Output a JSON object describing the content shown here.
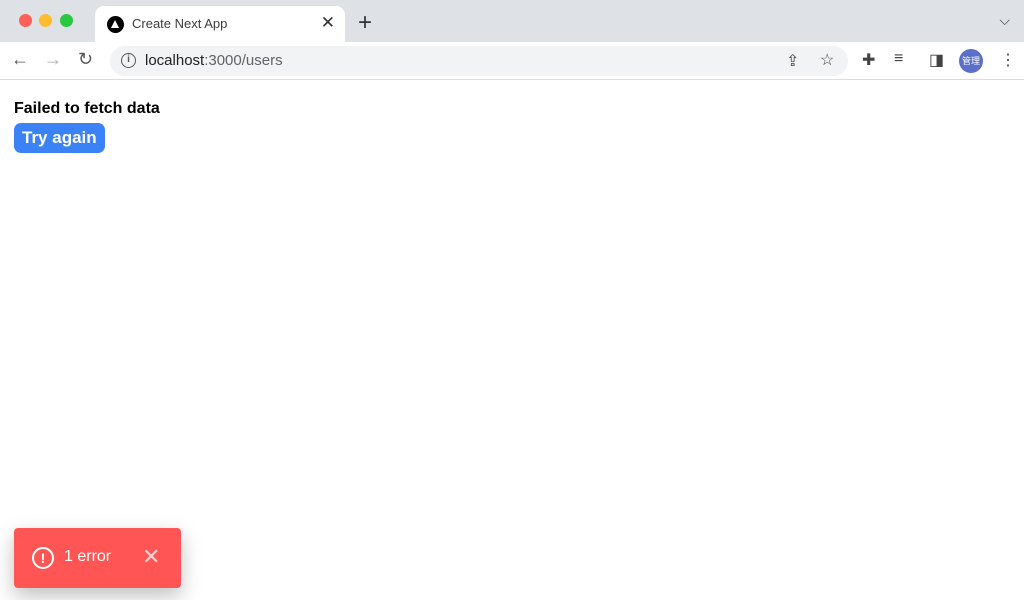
{
  "browser": {
    "tab_title": "Create Next App",
    "url_host": "localhost",
    "url_rest": ":3000/users",
    "profile_label": "管理",
    "colors": {
      "close": "#ff5f57",
      "minimize": "#febc2e",
      "zoom": "#28c840"
    }
  },
  "page": {
    "error_message": "Failed to fetch data",
    "retry_label": "Try again"
  },
  "toast": {
    "label": "1 error",
    "color": "#ff5555"
  }
}
